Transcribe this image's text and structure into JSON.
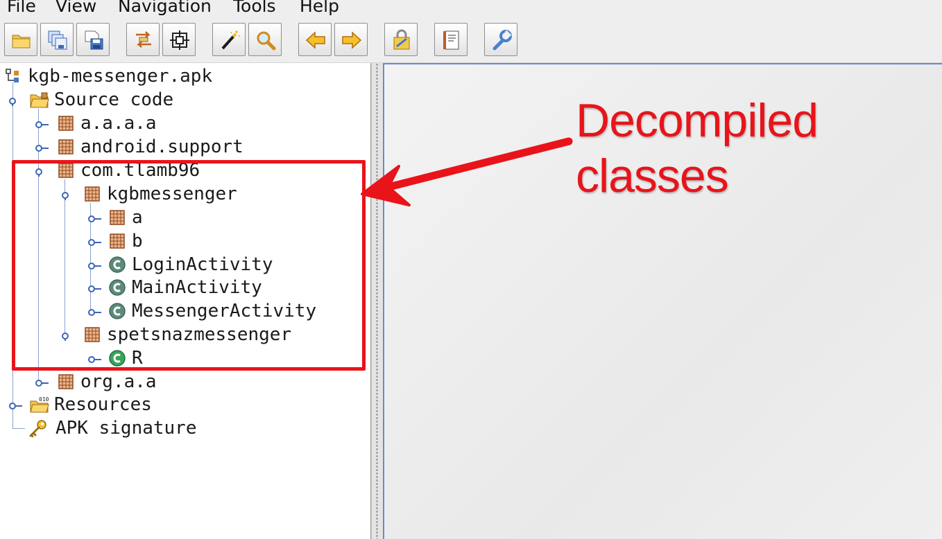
{
  "menu": {
    "file": "File",
    "view": "View",
    "navigation": "Navigation",
    "tools": "Tools",
    "help": "Help"
  },
  "toolbar": {
    "buttons": [
      "open-file-icon",
      "save-all-icon",
      "save-icon",
      "sync-icon",
      "flatten-packages-icon",
      "search-text-icon",
      "find-icon",
      "back-icon",
      "forward-icon",
      "decompile-all-icon",
      "log-viewer-icon",
      "preferences-icon"
    ]
  },
  "tree": {
    "root": "kgb-messenger.apk",
    "source_code": "Source code",
    "pkg_aaaa": "a.a.a.a",
    "pkg_android_support": "android.support",
    "pkg_com_tlamb96": "com.tlamb96",
    "pkg_kgbmessenger": "kgbmessenger",
    "pkg_a": "a",
    "pkg_b": "b",
    "class_login": "LoginActivity",
    "class_main": "MainActivity",
    "class_messenger": "MessengerActivity",
    "pkg_spetsnaz": "spetsnazmessenger",
    "class_r": "R",
    "pkg_org_a_a": "org.a.a",
    "resources": "Resources",
    "apk_signature": "APK signature"
  },
  "annotation": {
    "line1": "Decompiled",
    "line2": "classes",
    "color": "#e8141a"
  }
}
